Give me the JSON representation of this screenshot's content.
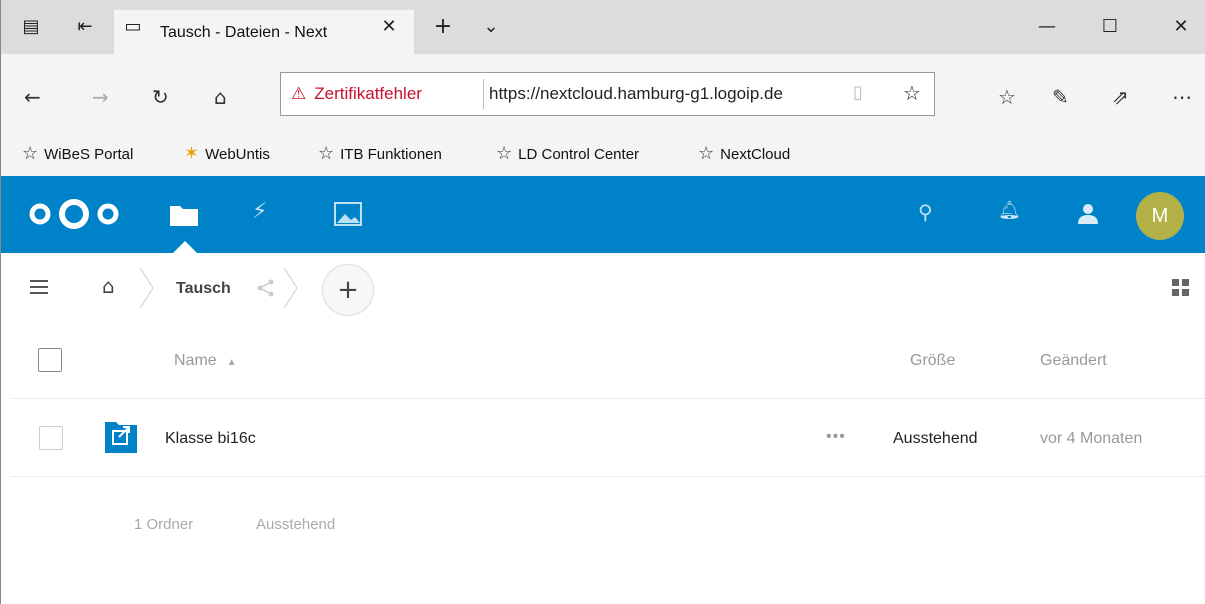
{
  "browser": {
    "tab_title": "Tausch - Dateien - Next",
    "cert_error": "Zertifikatfehler",
    "url": "https://nextcloud.hamburg-g1.logoip.de",
    "bookmarks": [
      "WiBeS Portal",
      "WebUntis",
      "ITB Funktionen",
      "LD Control Center",
      "NextCloud"
    ]
  },
  "nextcloud": {
    "avatar_initial": "M",
    "breadcrumb_current": "Tausch",
    "columns": {
      "name": "Name",
      "size": "Größe",
      "modified": "Geändert"
    },
    "files": [
      {
        "name": "Klasse bi16c",
        "size": "Ausstehend",
        "modified": "vor 4 Monaten"
      }
    ],
    "summary": {
      "folders": "1 Ordner",
      "size": "Ausstehend"
    }
  }
}
